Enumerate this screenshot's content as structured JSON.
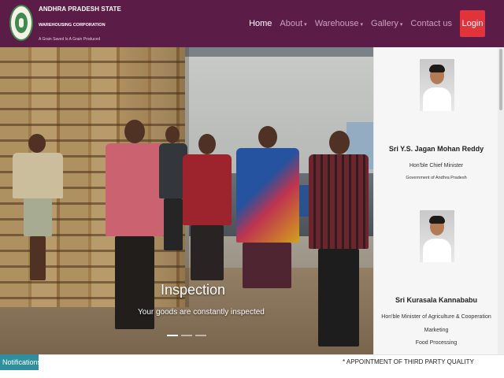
{
  "header": {
    "org_name": "ANDHRA PRADESH STATE",
    "org_sub": "WAREHOUSING CORPORATION",
    "tagline": "A Grain Saved Is A Grain Produced",
    "nav": [
      {
        "label": "Home",
        "active": true,
        "caret": ""
      },
      {
        "label": "About",
        "active": false,
        "caret": "▾"
      },
      {
        "label": "Warehouse",
        "active": false,
        "caret": "▾"
      },
      {
        "label": "Gallery",
        "active": false,
        "caret": "▾"
      },
      {
        "label": "Contact us",
        "active": false,
        "caret": ""
      }
    ],
    "login_label": "Login"
  },
  "hero": {
    "title": "Inspection",
    "subtitle": "Your goods are constantly inspected",
    "slide_count": 3,
    "active_slide": 1
  },
  "side": {
    "people": [
      {
        "name": "Sri Y.S. Jagan Mohan Reddy",
        "role": "Hon'ble Chief Minister",
        "org": "Government of Andhra Pradesh"
      },
      {
        "name": "Sri Kurasala Kannababu",
        "role": "Hon'ble Minister of Agriculture & Cooperation",
        "role2": "Marketing",
        "org": "Food Processing"
      }
    ]
  },
  "bottom": {
    "notifications_label": "Notifications",
    "ticker_text": "* APPOINTMENT OF THIRD PARTY QUALITY"
  },
  "colors": {
    "header_bg": "#5c1c48",
    "login_bg": "#e2333b",
    "notif_bg": "#2f8f9d"
  }
}
